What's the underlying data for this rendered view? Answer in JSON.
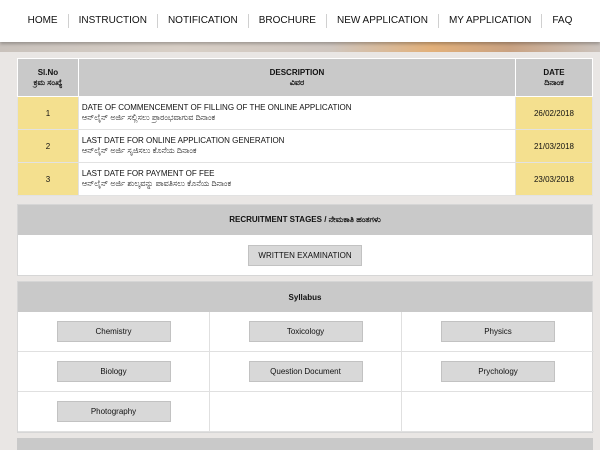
{
  "nav": {
    "items": [
      "HOME",
      "INSTRUCTION",
      "NOTIFICATION",
      "BROCHURE",
      "NEW APPLICATION",
      "MY APPLICATION",
      "FAQ"
    ]
  },
  "dates_table": {
    "headers": {
      "slno_en": "Sl.No",
      "slno_kn": "ಕ್ರಮ ಸಂಖ್ಯೆ",
      "desc_en": "DESCRIPTION",
      "desc_kn": "ವಿವರ",
      "date_en": "DATE",
      "date_kn": "ದಿನಾಂಕ"
    },
    "rows": [
      {
        "no": "1",
        "desc_en": "DATE OF COMMENCEMENT OF FILLING OF THE ONLINE APPLICATION",
        "desc_kn": "ಆನ್‌ಲೈನ್ ಅರ್ಜಿ ಸಲ್ಲಿಸಲು ಪ್ರಾರಂಭವಾಗುವ ದಿನಾಂಕ",
        "date": "26/02/2018"
      },
      {
        "no": "2",
        "desc_en": "LAST DATE FOR ONLINE APPLICATION GENERATION",
        "desc_kn": "ಆನ್‌ಲೈನ್ ಅರ್ಜಿ ಸೃಜಿಸಲು ಕೊನೆಯ ದಿನಾಂಕ",
        "date": "21/03/2018"
      },
      {
        "no": "3",
        "desc_en": "LAST DATE FOR PAYMENT OF FEE",
        "desc_kn": "ಆನ್‌ಲೈನ್ ಅರ್ಜಿ ಶುಲ್ಕವನ್ನು ಪಾವತಿಸಲು ಕೊನೆಯ ದಿನಾಂಕ",
        "date": "23/03/2018"
      }
    ]
  },
  "recruitment": {
    "title": "RECRUITMENT STAGES / ನೇಮಕಾತಿ ಹಂತಗಳು",
    "stage": "WRITTEN EXAMINATION"
  },
  "syllabus": {
    "title": "Syllabus",
    "items": [
      "Chemistry",
      "Toxicology",
      "Physics",
      "Biology",
      "Question Document",
      "Prychology",
      "Photography"
    ]
  }
}
